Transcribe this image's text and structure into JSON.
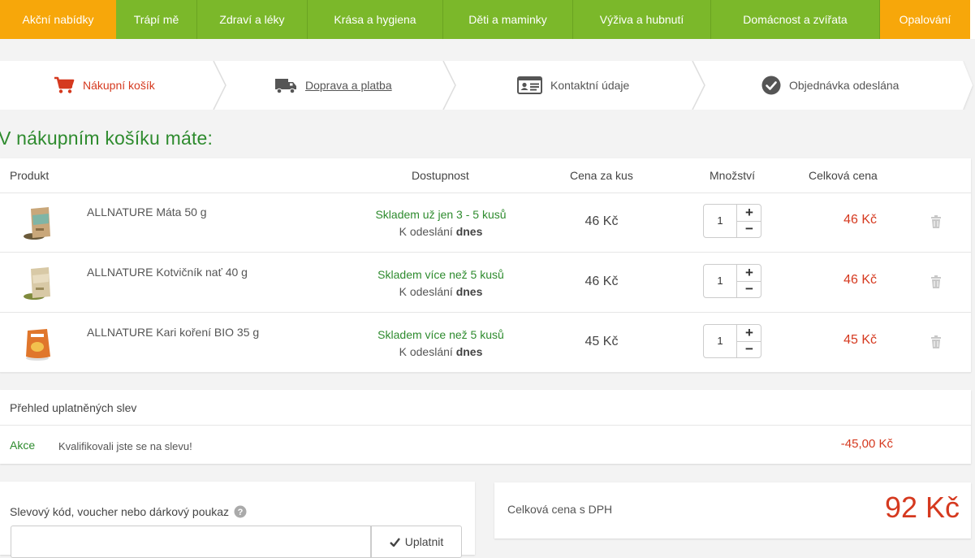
{
  "nav": {
    "items": [
      {
        "label": "Akční nabídky"
      },
      {
        "label": "Trápí mě"
      },
      {
        "label": "Zdraví a léky"
      },
      {
        "label": "Krása a hygiena"
      },
      {
        "label": "Děti a maminky"
      },
      {
        "label": "Výživa a hubnutí"
      },
      {
        "label": "Domácnost a zvířata"
      },
      {
        "label": "Opalování"
      }
    ],
    "colors": {
      "green": "#7bb82a",
      "orange": "#f7a70a"
    }
  },
  "steps": [
    {
      "label": "Nákupní košík",
      "icon": "cart-icon",
      "state": "active"
    },
    {
      "label": "Doprava a platba",
      "icon": "truck-icon",
      "state": "link"
    },
    {
      "label": "Kontaktní údaje",
      "icon": "id-card-icon",
      "state": "inactive"
    },
    {
      "label": "Objednávka odeslána",
      "icon": "check-circle-icon",
      "state": "inactive"
    }
  ],
  "cart": {
    "title": "V nákupním košíku máte:",
    "headers": {
      "product": "Produkt",
      "availability": "Dostupnost",
      "unit_price": "Cena za kus",
      "quantity": "Množství",
      "total": "Celková cena"
    },
    "items": [
      {
        "name": "ALLNATURE Máta 50 g",
        "stock": "Skladem už jen 3 - 5 kusů",
        "ship_prefix": "K odeslání",
        "ship_when": "dnes",
        "unit_price": "46 Kč",
        "qty": "1",
        "total": "46 Kč",
        "thumb": "mint-tea-bag"
      },
      {
        "name": "ALLNATURE Kotvičník nať 40 g",
        "stock": "Skladem více než 5 kusů",
        "ship_prefix": "K odeslání",
        "ship_when": "dnes",
        "unit_price": "46 Kč",
        "qty": "1",
        "total": "46 Kč",
        "thumb": "herb-bag"
      },
      {
        "name": "ALLNATURE Kari koření BIO 35 g",
        "stock": "Skladem více než 5 kusů",
        "ship_prefix": "K odeslání",
        "ship_when": "dnes",
        "unit_price": "45 Kč",
        "qty": "1",
        "total": "45 Kč",
        "thumb": "curry-pouch"
      }
    ]
  },
  "discounts": {
    "title": "Přehled uplatněných slev",
    "rows": [
      {
        "name": "Akce",
        "message": "Kvalifikovali jste se na slevu!",
        "amount": "-45,00 Kč"
      }
    ]
  },
  "voucher": {
    "label": "Slevový kód, voucher nebo dárkový poukaz",
    "value": "",
    "placeholder": "",
    "button": "Uplatnit"
  },
  "summary": {
    "label": "Celková cena s DPH",
    "value": "92 Kč"
  },
  "colors": {
    "accent_red": "#d5391f",
    "accent_green": "#2e8b2e"
  }
}
